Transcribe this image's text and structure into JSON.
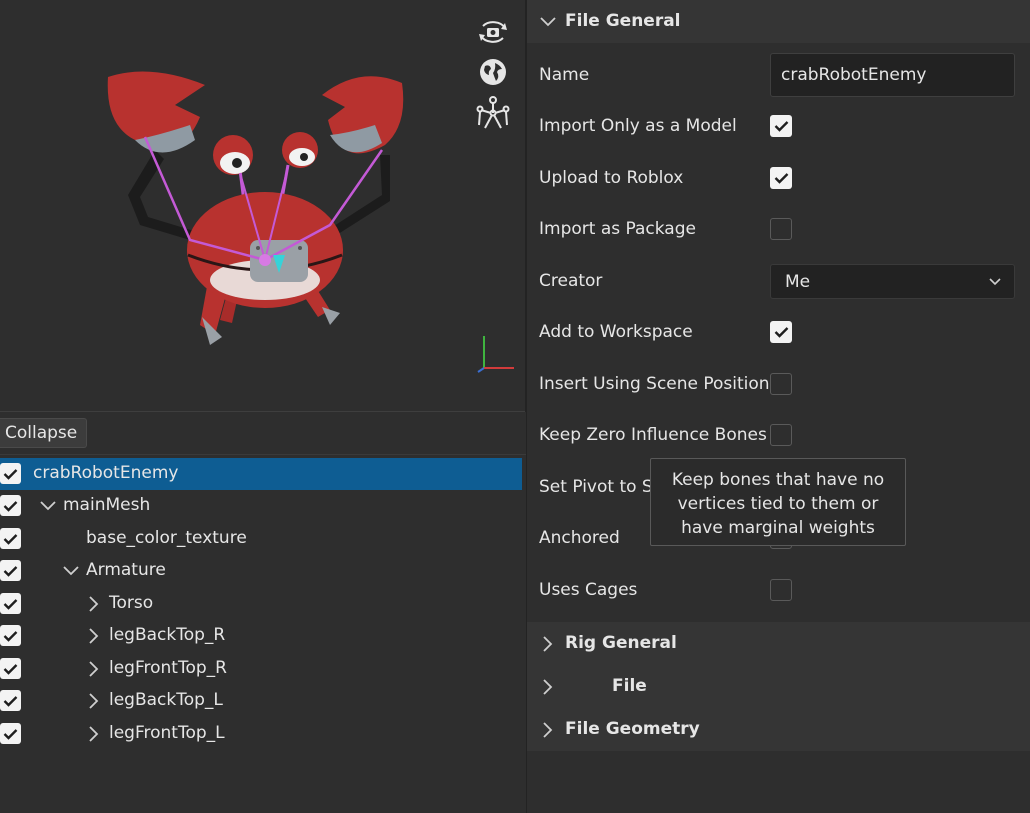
{
  "viewport": {
    "icons": [
      "camera-orbit-icon",
      "globe-icon",
      "skeleton-rig-icon"
    ]
  },
  "tree": {
    "collapse_label": "Collapse",
    "items": [
      {
        "label": "crabRobotEnemy",
        "checked": true,
        "expanded": true,
        "selected": true
      },
      {
        "label": "mainMesh",
        "checked": true,
        "expanded": true
      },
      {
        "label": "base_color_texture",
        "checked": true
      },
      {
        "label": "Armature",
        "checked": true,
        "expanded": true
      },
      {
        "label": "Torso",
        "checked": true,
        "expanded": false
      },
      {
        "label": "legBackTop_R",
        "checked": true,
        "expanded": false
      },
      {
        "label": "legFrontTop_R",
        "checked": true,
        "expanded": false
      },
      {
        "label": "legBackTop_L",
        "checked": true,
        "expanded": false
      },
      {
        "label": "legFrontTop_L",
        "checked": true,
        "expanded": false
      }
    ]
  },
  "props": {
    "sections": {
      "file_general": "File General",
      "rig_general": "Rig General",
      "file": "File",
      "file_geometry": "File Geometry"
    },
    "name": {
      "label": "Name",
      "value": "crabRobotEnemy"
    },
    "import_only_model": {
      "label": "Import Only as a Model",
      "checked": true
    },
    "upload_to_roblox": {
      "label": "Upload to Roblox",
      "checked": true
    },
    "import_as_package": {
      "label": "Import as Package",
      "checked": false
    },
    "creator": {
      "label": "Creator",
      "value": "Me"
    },
    "add_to_workspace": {
      "label": "Add to Workspace",
      "checked": true
    },
    "insert_scene_position": {
      "label": "Insert Using Scene Position",
      "checked": false
    },
    "keep_zero_influence": {
      "label": "Keep Zero Influence Bones",
      "checked": false
    },
    "set_pivot": {
      "label": "Set Pivot to S",
      "checked": false
    },
    "anchored": {
      "label": "Anchored",
      "checked": false
    },
    "uses_cages": {
      "label": "Uses Cages",
      "checked": false
    }
  },
  "tooltip": {
    "text": "Keep bones that have no vertices tied to them or have marginal weights"
  },
  "colors": {
    "selection": "#0e5d93",
    "crab_red": "#b8322f",
    "bone_pink": "#c45ad6"
  }
}
